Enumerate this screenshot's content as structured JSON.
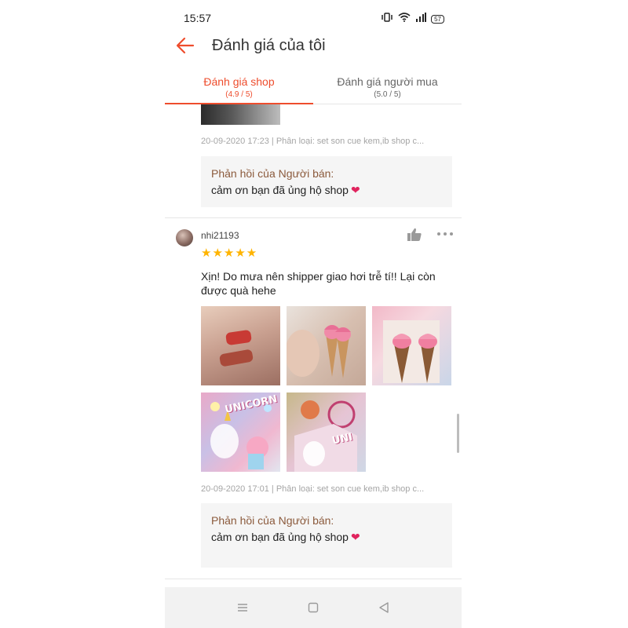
{
  "status_bar": {
    "time": "15:57",
    "battery": "57",
    "icons": [
      "vibrate-icon",
      "wifi-icon",
      "signal-icon",
      "battery-icon"
    ]
  },
  "header": {
    "title": "Đánh giá của tôi",
    "back_icon": "arrow-left-icon"
  },
  "tabs": [
    {
      "label": "Đánh giá shop",
      "rating": "(4.9 / 5)",
      "active": true
    },
    {
      "label": "Đánh giá người mua",
      "rating": "(5.0 / 5)",
      "active": false
    }
  ],
  "previous_review": {
    "meta": "20-09-2020 17:23 | Phân loại: set son cue kem,ib shop c...",
    "reply_heading": "Phản hồi của Người bán:",
    "reply_text": "cảm ơn bạn đã ủng hộ shop"
  },
  "review": {
    "username": "nhi21193",
    "stars": "★★★★★",
    "rating": 5,
    "text": "Xịn! Do mưa nên shipper giao hơi trễ tí!! Lại còn được quà hehe",
    "photos": [
      {
        "name": "lip-swatch-photo"
      },
      {
        "name": "lipstick-in-hand-photo"
      },
      {
        "name": "lipstick-in-box-photo"
      },
      {
        "name": "unicorn-box-photo",
        "label": "UNICORN"
      },
      {
        "name": "unicorn-box-side-photo",
        "label": "UNI"
      }
    ],
    "meta": "20-09-2020 17:01 | Phân loại: set son cue kem,ib shop c...",
    "reply_heading": "Phản hồi của Người bán:",
    "reply_text": "cảm ơn bạn đã ủng hộ shop"
  },
  "colors": {
    "accent": "#ee4d2d",
    "star": "#ffb400",
    "reply_heading": "#8b5a3c",
    "meta_text": "#a5a5a5"
  }
}
